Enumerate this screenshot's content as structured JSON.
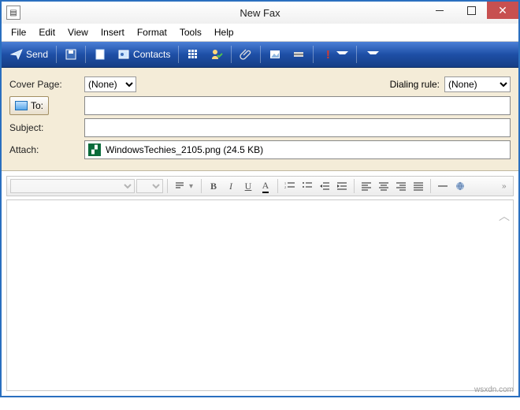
{
  "window": {
    "title": "New Fax"
  },
  "menu": {
    "file": "File",
    "edit": "Edit",
    "view": "View",
    "insert": "Insert",
    "format": "Format",
    "tools": "Tools",
    "help": "Help"
  },
  "toolbar": {
    "send": "Send",
    "contacts": "Contacts"
  },
  "fields": {
    "cover_label": "Cover Page:",
    "cover_value": "(None)",
    "dialing_label": "Dialing rule:",
    "dialing_value": "(None)",
    "to_button": "To:",
    "to_value": "",
    "subject_label": "Subject:",
    "subject_value": "",
    "attach_label": "Attach:",
    "attach_file": "WindowsTechies_2105.png (24.5 KB)"
  },
  "footer": "wsxdn.com"
}
